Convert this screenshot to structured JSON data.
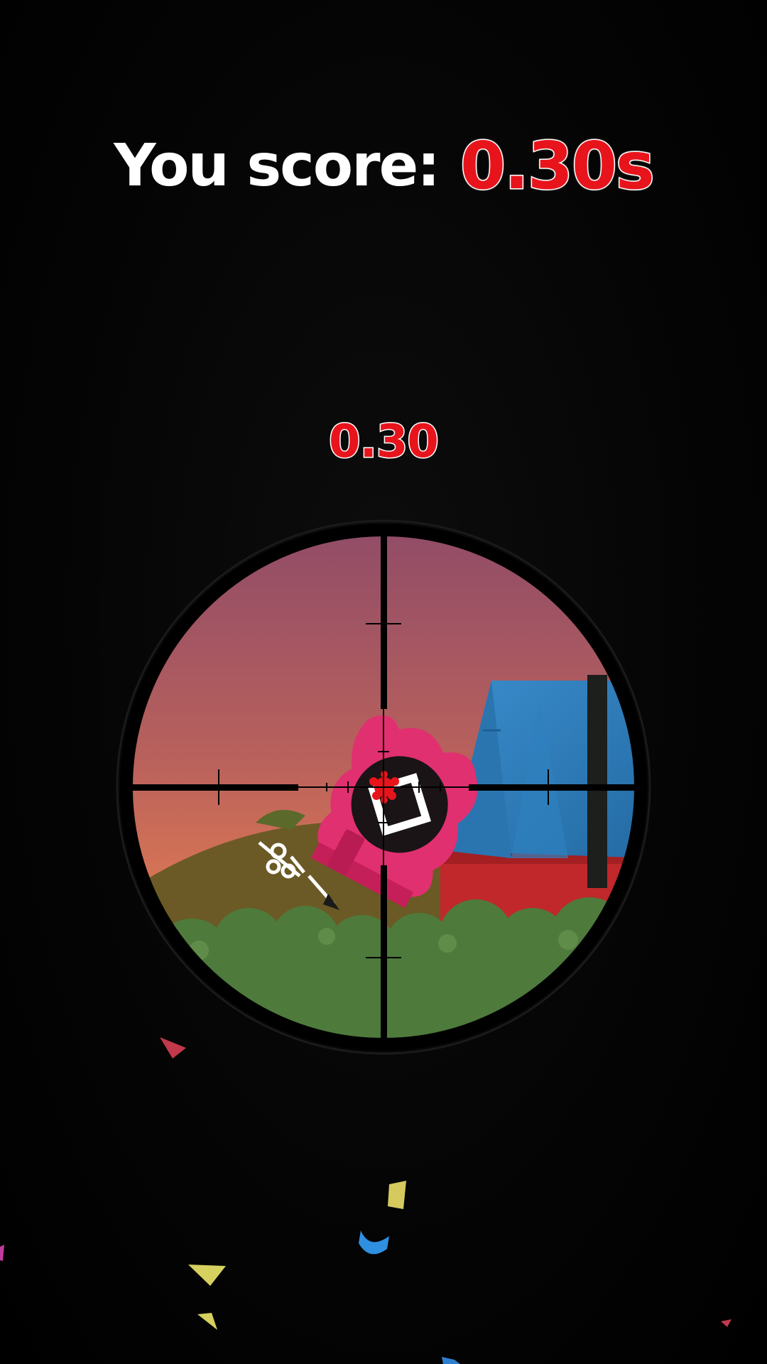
{
  "hud": {
    "score_label": "You score:",
    "score_value": "0.30s",
    "timer": "0.30",
    "score_color": "#e8141c"
  },
  "scope": {
    "target": "pink-square-guard",
    "icons": [
      "crosshair-icon",
      "square-mask-icon"
    ]
  },
  "colors": {
    "sky_top": "#8f4b68",
    "sky_bottom": "#e07a52",
    "hill": "#6b5a25",
    "bushes": "#4e7a3c",
    "tent": "#2f7ab6",
    "wall": "#c0282b",
    "guard": "#e0306f"
  }
}
